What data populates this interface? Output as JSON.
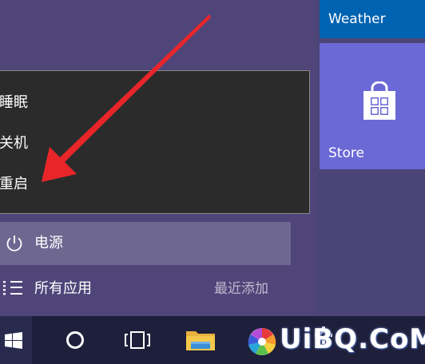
{
  "power_menu": {
    "items": [
      {
        "label": "睡眠"
      },
      {
        "label": "关机"
      },
      {
        "label": "重启"
      }
    ]
  },
  "power_button": {
    "label": "电源",
    "icon": "power-icon"
  },
  "all_apps": {
    "label": "所有应用",
    "icon": "list-icon"
  },
  "recently_added": {
    "label": "最近添加"
  },
  "tiles": {
    "weather": {
      "label": "Weather",
      "color": "#0063b1"
    },
    "store": {
      "label": "Store",
      "color": "#6b69d6",
      "icon": "store-bag-icon"
    }
  },
  "taskbar": {
    "icons": [
      "windows-start-icon",
      "cortana-circle-icon",
      "task-view-icon",
      "file-explorer-icon",
      "photos-pinwheel-icon",
      "settings-gear-icon"
    ]
  },
  "watermark": {
    "text": "UiBQ.CoM"
  },
  "colors": {
    "start_menu_bg": "#4f4579",
    "menu_bg": "#2b2b2b",
    "highlight": "#6e6790",
    "taskbar": "#1e1f3a",
    "arrow": "#e8262a"
  }
}
